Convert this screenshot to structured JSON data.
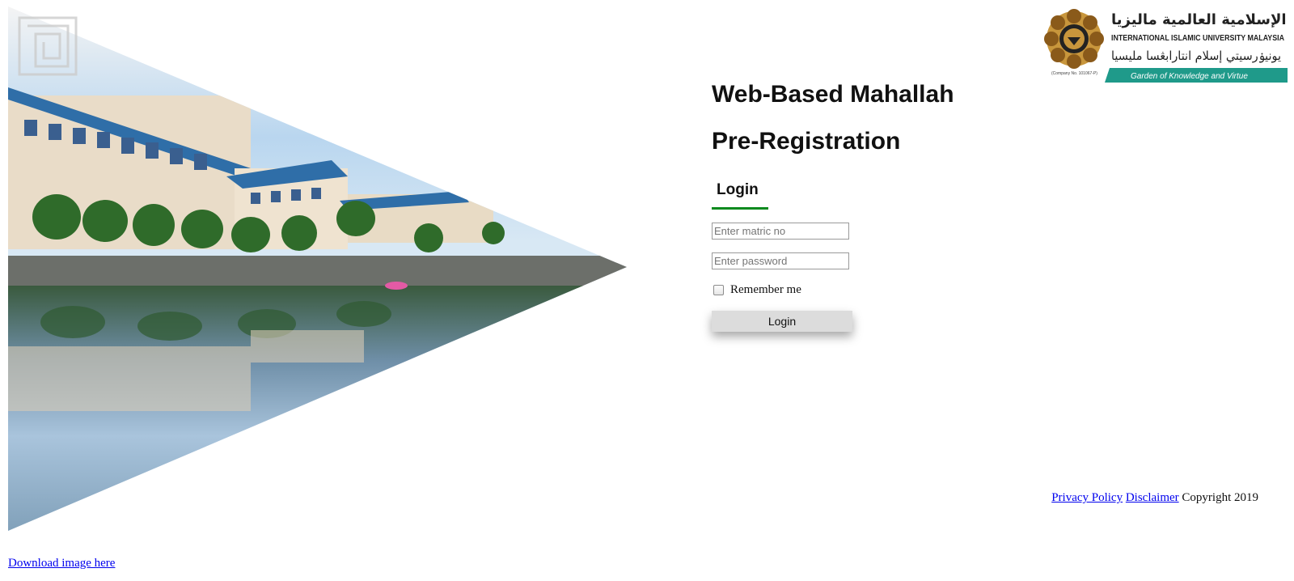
{
  "page": {
    "title_line1": "Web-Based Mahallah",
    "title_line2": "Pre-Registration"
  },
  "logo": {
    "arabic_name": "الجامعة الإسلامية العالمية ماليزيا",
    "english_name": "INTERNATIONAL ISLAMIC UNIVERSITY MALAYSIA",
    "jawi_name": "يونيۏرسيتي إسلام انتارابڠسا مليسيا",
    "company_no": "(Company No. 101067-P)",
    "tagline": "Garden of Knowledge and Virtue",
    "colors": {
      "gold": "#c8963c",
      "teal": "#1f9a8a",
      "dark": "#222222"
    }
  },
  "login": {
    "heading": "Login",
    "matric_placeholder": "Enter matric no",
    "password_placeholder": "Enter password",
    "remember_label": "Remember me",
    "button_label": "Login",
    "accent_color": "#0b8a1e"
  },
  "footer": {
    "privacy_link": "Privacy Policy",
    "disclaimer_link": "Disclaimer",
    "copyright": "Copyright 2019"
  },
  "download_link": "Download image here",
  "hero": {
    "icon": "campus-photo-triangle"
  }
}
